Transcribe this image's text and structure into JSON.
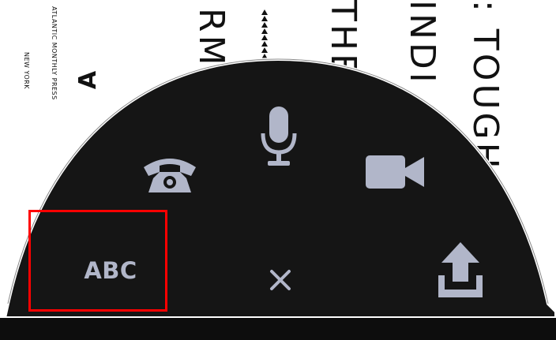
{
  "background_book": {
    "publisher": "ATLANTIC MONTHLY PRESS",
    "city": "NEW YORK",
    "title_fragments": [
      "RMA",
      "THE",
      "INDI",
      ": TOUGH"
    ]
  },
  "radial_menu": {
    "items": [
      {
        "id": "abc",
        "label": "ABC",
        "icon": "keyboard-text-icon"
      },
      {
        "id": "phone",
        "icon": "phone-icon"
      },
      {
        "id": "mic",
        "icon": "microphone-icon"
      },
      {
        "id": "video",
        "icon": "video-camera-icon"
      },
      {
        "id": "close",
        "label": "×",
        "icon": "close-icon"
      },
      {
        "id": "upload",
        "icon": "upload-icon"
      }
    ],
    "selected": "abc"
  },
  "colors": {
    "menu_background": "#151515",
    "menu_border": "#ffffff",
    "icon": "#b1b6c9",
    "selection": "#ff0000"
  }
}
